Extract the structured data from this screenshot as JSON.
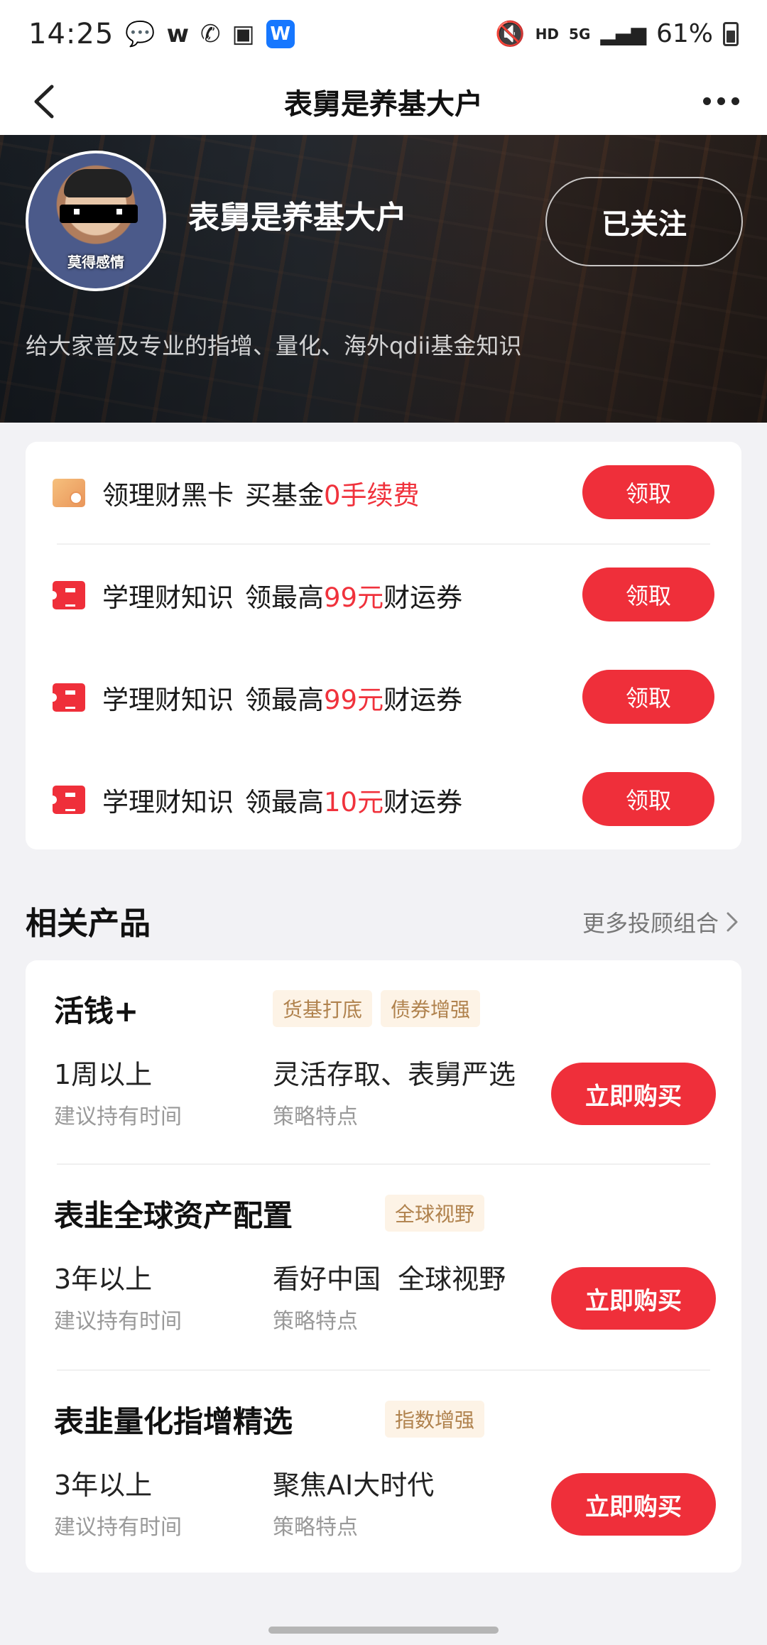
{
  "status_bar": {
    "time": "14:25",
    "left_icons": [
      "message-icon",
      "w-icon",
      "wifi-call-icon",
      "gallery-icon",
      "app-icon"
    ],
    "w_glyph": "w",
    "app_glyph": "W",
    "hd": "HD",
    "network": "5G",
    "battery": "61%"
  },
  "nav": {
    "title": "表舅是养基大户"
  },
  "profile": {
    "name": "表舅是养基大户",
    "avatar_caption": "莫得感情",
    "follow_label": "已关注",
    "description": "给大家普及专业的指增、量化、海外qdii基金知识"
  },
  "promos": [
    {
      "icon": "black-card-icon",
      "text_before": "领理财黑卡",
      "text_mid": "买基金",
      "highlight": "0手续费",
      "text_after": "",
      "button": "领取"
    },
    {
      "icon": "coupon-icon",
      "text_before": "学理财知识",
      "text_mid": "领最高",
      "highlight": "99元",
      "text_after": "财运券",
      "button": "领取"
    },
    {
      "icon": "coupon-icon",
      "text_before": "学理财知识",
      "text_mid": "领最高",
      "highlight": "99元",
      "text_after": "财运券",
      "button": "领取"
    },
    {
      "icon": "coupon-icon",
      "text_before": "学理财知识",
      "text_mid": "领最高",
      "highlight": "10元",
      "text_after": "财运券",
      "button": "领取"
    }
  ],
  "section": {
    "title": "相关产品",
    "more": "更多投顾组合"
  },
  "products": [
    {
      "name": "活钱+",
      "tags": [
        "货基打底",
        "债券增强"
      ],
      "period": "1周以上",
      "period_label": "建议持有时间",
      "feature": "灵活存取、表舅严选",
      "feature_label": "策略特点",
      "button": "立即购买"
    },
    {
      "name": "表韭全球资产配置",
      "tags": [
        "全球视野"
      ],
      "period": "3年以上",
      "period_label": "建议持有时间",
      "feature": "看好中国  全球视野",
      "feature_label": "策略特点",
      "button": "立即购买"
    },
    {
      "name": "表韭量化指增精选",
      "tags": [
        "指数增强"
      ],
      "period": "3年以上",
      "period_label": "建议持有时间",
      "feature": "聚焦AI大时代",
      "feature_label": "策略特点",
      "button": "立即购买"
    }
  ],
  "colors": {
    "accent_red": "#ef2f3a",
    "tag_bg": "#fdf3e6",
    "tag_text": "#b0824d",
    "page_bg": "#f2f2f5"
  }
}
